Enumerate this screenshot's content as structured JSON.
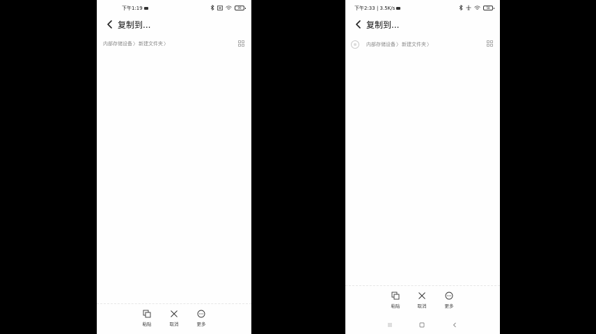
{
  "left_screen": {
    "status": {
      "time": "下午1:19",
      "battery": "99"
    },
    "title": "复制到...",
    "breadcrumb": {
      "root": "内部存储设备",
      "separator": "〉",
      "folder": "新建文件夹",
      "trailing": "〉"
    },
    "actions": {
      "paste": "粘贴",
      "cancel": "取消",
      "more": "更多"
    }
  },
  "right_screen": {
    "status": {
      "time": "下午2:33 | 3.5K/s",
      "battery": "58"
    },
    "title": "复制到...",
    "breadcrumb": {
      "root": "内部存储设备",
      "separator": "〉",
      "folder": "新建文件夹",
      "trailing": "〉"
    },
    "actions": {
      "paste": "粘贴",
      "cancel": "取消",
      "more": "更多"
    }
  },
  "icons": {
    "back": "chevron-left-icon",
    "grid": "grid-view-icon",
    "paste": "copy-paste-icon",
    "cancel": "close-icon",
    "more": "more-dots-icon",
    "nav_menu": "menu-icon",
    "nav_home": "home-square-icon",
    "nav_back": "back-triangle-icon"
  },
  "colors": {
    "background": "#000000",
    "screen": "#fefefe",
    "text": "#111111",
    "muted": "#888888"
  }
}
